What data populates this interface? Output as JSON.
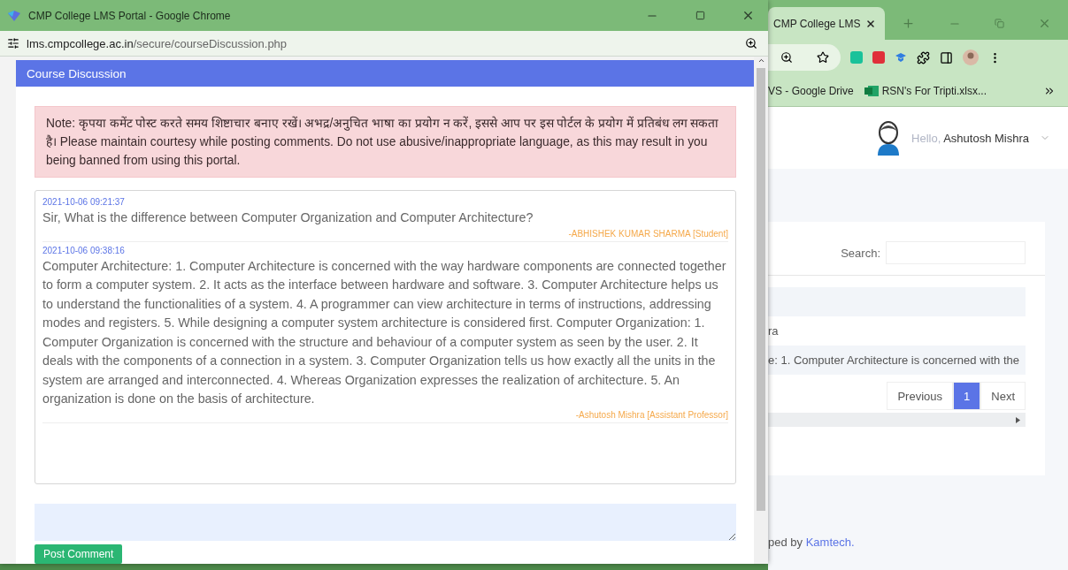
{
  "popup": {
    "title": "CMP College LMS Portal - Google Chrome",
    "url_host": "lms.cmpcollege.ac.in",
    "url_path": "/secure/courseDiscussion.php",
    "modal_title": "Course Discussion",
    "note": "Note: कृपया कमेंट पोस्ट करते समय शिष्टाचार बनाए रखें। अभद्र/अनुचित भाषा का प्रयोग न करें, इससे आप पर इस पोर्टल के प्रयोग में प्रतिबंध लग सकता है। Please maintain courtesy while posting comments. Do not use abusive/inappropriate language, as this may result in you being banned from using this portal.",
    "comments": [
      {
        "timestamp": "2021-10-06 09:21:37",
        "text": "Sir, What is the difference between Computer Organization and Computer Architecture?",
        "author": "-ABHISHEK KUMAR SHARMA [Student]"
      },
      {
        "timestamp": "2021-10-06 09:38:16",
        "text": "Computer Architecture: 1. Computer Architecture is concerned with the way hardware components are connected together to form a computer system. 2. It acts as the interface between hardware and software. 3. Computer Architecture helps us to understand the functionalities of a system. 4. A programmer can view architecture in terms of instructions, addressing modes and registers. 5. While designing a computer system architecture is considered first. Computer Organization: 1. Computer Organization is concerned with the structure and behaviour of a computer system as seen by the user. 2. It deals with the components of a connection in a system. 3. Computer Organization tells us how exactly all the units in the system are arranged and interconnected. 4. Whereas Organization expresses the realization of architecture. 5. An organization is done on the basis of architecture.",
        "author": "-Ashutosh Mishra [Assistant Professor]"
      }
    ],
    "post_button": "Post Comment"
  },
  "browser": {
    "tabs": [
      {
        "title": "CMP College LMS",
        "selected": true
      }
    ],
    "bookmarks": [
      "VS - Google Drive",
      "RSN's For Tripti.xlsx..."
    ],
    "user": {
      "greeting": "Hello,",
      "name": "Ashutosh Mishra"
    },
    "search_label": "Search:",
    "rows": [
      {
        "text": "ra",
        "striped": false
      },
      {
        "text": "e: 1. Computer Architecture is concerned with the",
        "striped": true
      }
    ],
    "pagination": [
      {
        "label": "Previous",
        "selected": false
      },
      {
        "label": "1",
        "selected": true
      },
      {
        "label": "Next",
        "selected": false
      }
    ],
    "footer": {
      "text": "ped by",
      "link": "Kamtech."
    }
  }
}
